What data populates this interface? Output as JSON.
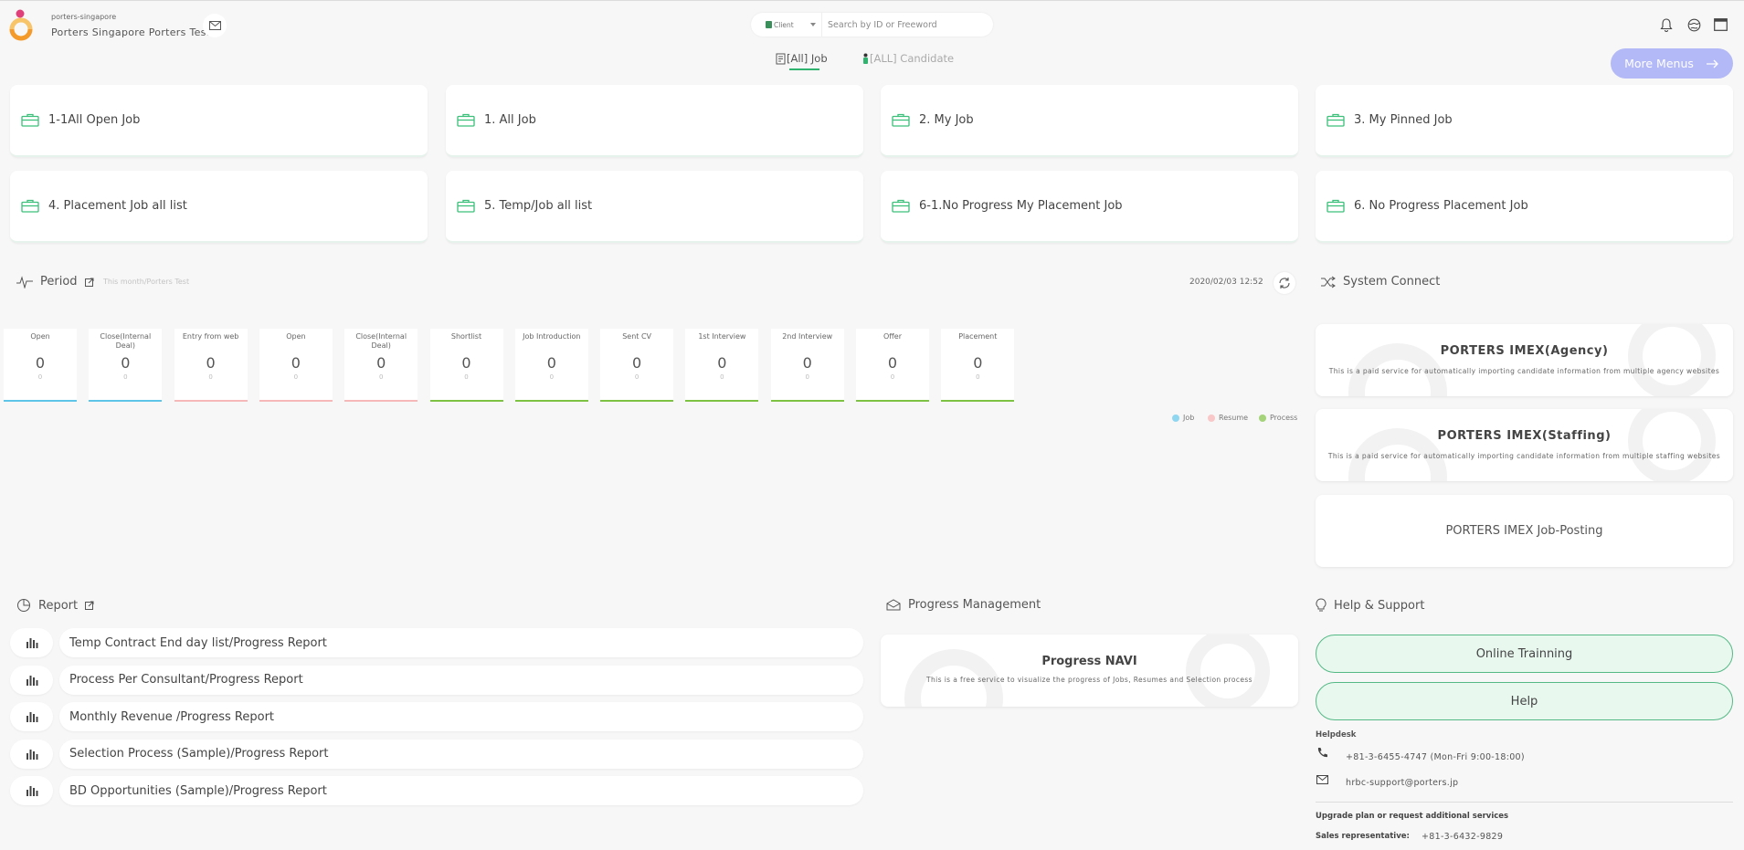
{
  "header": {
    "company_small": "porters-singapore",
    "company_name": "Porters Singapore Porters Test",
    "search_type": "Client",
    "search_placeholder": "Search by ID or Freeword"
  },
  "tabs": {
    "job": "[All] Job",
    "candidate": "[ALL] Candidate"
  },
  "more_menus": "More Menus",
  "job_cards": [
    "1-1All Open Job",
    "1. All Job",
    "2. My Job",
    "3. My Pinned Job",
    "4. Placement Job all list",
    "5. Temp/Job all list",
    "6-1.No Progress My Placement Job",
    "6. No Progress Placement Job"
  ],
  "period": {
    "title": "Period",
    "subtitle": "This month/Porters Test",
    "datetime": "2020/02/03 12:52",
    "stats": [
      {
        "label": "Open",
        "value": "0",
        "sub": "0",
        "color": "#5ec4e8"
      },
      {
        "label": "Close(Internal Deal)",
        "value": "0",
        "sub": "0",
        "color": "#5ec4e8"
      },
      {
        "label": "Entry from web",
        "value": "0",
        "sub": "0",
        "color": "#f6b8b8"
      },
      {
        "label": "Open",
        "value": "0",
        "sub": "0",
        "color": "#f6b8b8"
      },
      {
        "label": "Close(Internal Deal)",
        "value": "0",
        "sub": "0",
        "color": "#f6b8b8"
      },
      {
        "label": "Shortlist",
        "value": "0",
        "sub": "0",
        "color": "#7dc242"
      },
      {
        "label": "Job Introduction",
        "value": "0",
        "sub": "0",
        "color": "#7dc242"
      },
      {
        "label": "Sent CV",
        "value": "0",
        "sub": "0",
        "color": "#7dc242"
      },
      {
        "label": "1st Interview",
        "value": "0",
        "sub": "0",
        "color": "#7dc242"
      },
      {
        "label": "2nd Interview",
        "value": "0",
        "sub": "0",
        "color": "#7dc242"
      },
      {
        "label": "Offer",
        "value": "0",
        "sub": "0",
        "color": "#7dc242"
      },
      {
        "label": "Placement",
        "value": "0",
        "sub": "0",
        "color": "#7dc242"
      }
    ],
    "legend": [
      {
        "label": "Job",
        "color": "#8fd6f1"
      },
      {
        "label": "Resume",
        "color": "#f9c7c7"
      },
      {
        "label": "Process",
        "color": "#a4d37a"
      }
    ]
  },
  "system_connect": {
    "title": "System Connect",
    "cards": [
      {
        "title": "PORTERS IMEX(Agency)",
        "desc": "This is a paid service for automatically importing candidate information from multiple agency websites"
      },
      {
        "title": "PORTERS IMEX(Staffing)",
        "desc": "This is a paid service for automatically importing candidate information from multiple staffing websites"
      }
    ],
    "job_posting": "PORTERS IMEX Job-Posting"
  },
  "report": {
    "title": "Report",
    "items": [
      "Temp Contract End day list/Progress Report",
      "Process Per Consultant/Progress Report",
      "Monthly Revenue /Progress Report",
      "Selection Process (Sample)/Progress Report",
      "BD Opportunities (Sample)/Progress Report"
    ]
  },
  "progress": {
    "title": "Progress Management",
    "card_title": "Progress NAVI",
    "card_desc": "This is a free service to visualize the progress of Jobs, Resumes and Selection process"
  },
  "help": {
    "title": "Help & Support",
    "online_training": "Online Trainning",
    "help": "Help",
    "helpdesk": "Helpdesk",
    "phone": "+81-3-6455-4747 (Mon-Fri 9:00-18:00)",
    "email": "hrbc-support@porters.jp",
    "upgrade": "Upgrade plan or request additional services",
    "sales_label": "Sales representative:",
    "sales_phone": "+81-3-6432-9829"
  },
  "colors": {
    "accent_green": "#2fb36f",
    "more_menus": "#b3b9f6"
  }
}
